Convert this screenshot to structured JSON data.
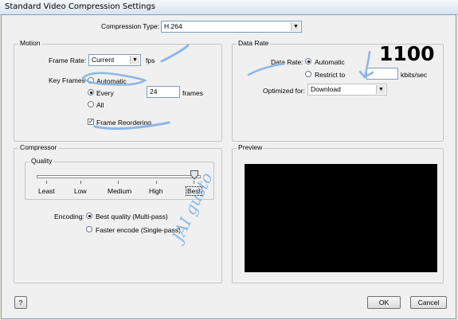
{
  "window": {
    "title": "Standard Video Compression Settings"
  },
  "compression": {
    "label": "Compression Type:",
    "value": "H.264"
  },
  "motion": {
    "group_title": "Motion",
    "frame_rate_label": "Frame Rate:",
    "frame_rate_value": "Current",
    "fps_label": "fps",
    "key_frames_label": "Key Frames",
    "automatic_label": "Automatic",
    "every_label": "Every",
    "every_value": "24",
    "frames_label": "frames",
    "all_label": "All",
    "reorder_label": "Frame Reordering",
    "reorder_checked": true
  },
  "data_rate": {
    "group_title": "Data Rate",
    "label": "Data Rate:",
    "automatic_label": "Automatic",
    "restrict_label": "Restrict to",
    "restrict_value": "",
    "unit_label": "kbits/sec",
    "optimized_label": "Optimized for:",
    "optimized_value": "Download"
  },
  "compressor": {
    "group_title": "Compressor",
    "quality_title": "Quality",
    "quality_levels": [
      "Least",
      "Low",
      "Medium",
      "High",
      "Best"
    ],
    "quality_selected": "Best",
    "encoding_label": "Encoding:",
    "best_quality_label": "Best quality (Multi-pass)",
    "faster_label": "Faster encode (Single-pass)"
  },
  "preview": {
    "group_title": "Preview"
  },
  "buttons": {
    "help": "?",
    "ok": "OK",
    "cancel": "Cancel"
  },
  "annotations": {
    "number": "1100",
    "handwriting": "JAI gusto"
  },
  "colors": {
    "ink_blue": "#8ab8e8",
    "ink_black": "#000000",
    "dialog_bg": "#f0f0f0"
  }
}
